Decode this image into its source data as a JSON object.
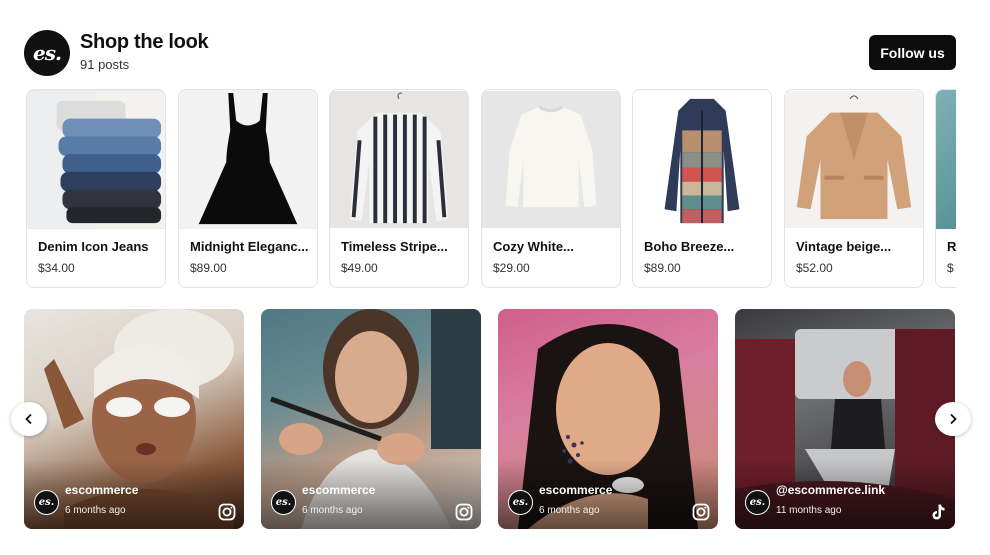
{
  "header": {
    "logo_text": "es.",
    "title": "Shop the look",
    "posts_count": "91 posts",
    "follow_label": "Follow us"
  },
  "products": [
    {
      "name": "Denim Icon Jeans",
      "price": "$34.00",
      "icon": "jeans-stack-photo"
    },
    {
      "name": "Midnight Eleganc...",
      "price": "$89.00",
      "icon": "black-dress-photo"
    },
    {
      "name": "Timeless Stripe...",
      "price": "$49.00",
      "icon": "striped-shirt-photo"
    },
    {
      "name": "Cozy White...",
      "price": "$29.00",
      "icon": "white-sweater-photo"
    },
    {
      "name": "Boho Breeze...",
      "price": "$89.00",
      "icon": "boho-cardigan-photo"
    },
    {
      "name": "Vintage beige...",
      "price": "$52.00",
      "icon": "beige-blazer-photo"
    },
    {
      "name": "R",
      "price": "$",
      "icon": "partial-product-photo"
    }
  ],
  "posts": [
    {
      "handle": "escommerce",
      "time": "6 months ago",
      "platform": "instagram-icon"
    },
    {
      "handle": "escommerce",
      "time": "6 months ago",
      "platform": "instagram-icon"
    },
    {
      "handle": "escommerce",
      "time": "6 months ago",
      "platform": "instagram-icon"
    },
    {
      "handle": "@escommerce.link",
      "time": "11 months ago",
      "platform": "tiktok-icon"
    }
  ],
  "avatar_text": "es.",
  "colors": {
    "accent": "#0d0d0d",
    "card_border": "#e3e3e3"
  }
}
